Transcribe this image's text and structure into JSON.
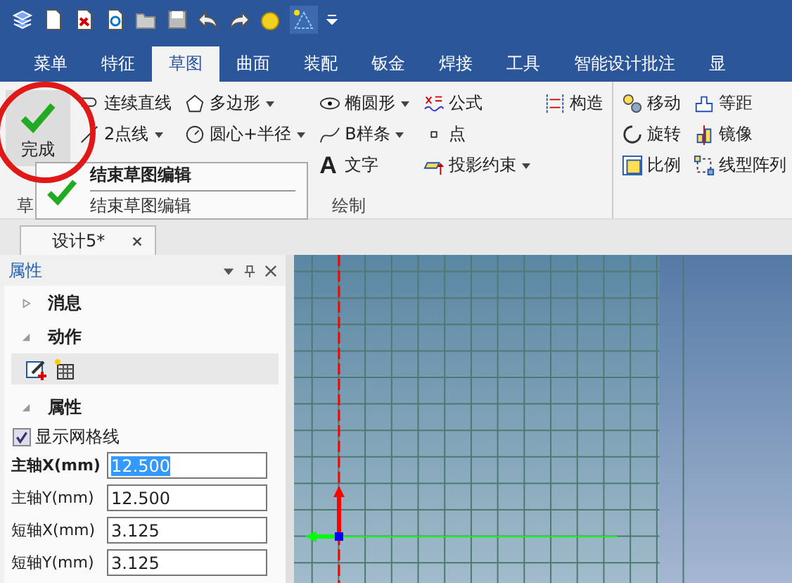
{
  "tabs": [
    {
      "label": "菜单",
      "selected": false
    },
    {
      "label": "特征",
      "selected": false
    },
    {
      "label": "草图",
      "selected": true
    },
    {
      "label": "曲面",
      "selected": false
    },
    {
      "label": "装配",
      "selected": false
    },
    {
      "label": "钣金",
      "selected": false
    },
    {
      "label": "焊接",
      "selected": false
    },
    {
      "label": "工具",
      "selected": false
    },
    {
      "label": "智能设计批注",
      "selected": false
    },
    {
      "label": "显",
      "selected": false
    }
  ],
  "ribbon": {
    "finish_button": "完成",
    "groups": [
      {
        "label": "草"
      },
      {
        "label": "绘制",
        "columns": [
          [
            {
              "kind": "polyline",
              "label": "连续直线",
              "dropdown": false
            },
            {
              "kind": "line",
              "label": "2点线",
              "dropdown": true
            }
          ],
          [
            {
              "kind": "polygon",
              "label": "多边形",
              "dropdown": true
            },
            {
              "kind": "circle",
              "label": "圆心+半径",
              "dropdown": true
            }
          ],
          [
            {
              "kind": "ellipse",
              "label": "椭圆形",
              "dropdown": true
            },
            {
              "kind": "spline",
              "label": "B样条",
              "dropdown": true
            },
            {
              "kind": "text",
              "icon": "A",
              "label": "文字",
              "dropdown": false
            }
          ],
          [
            {
              "kind": "formula",
              "label": "公式",
              "dropdown": false
            },
            {
              "kind": "point",
              "label": "点",
              "dropdown": false
            },
            {
              "kind": "project",
              "label": "投影约束",
              "dropdown": true
            }
          ],
          [
            {
              "kind": "construct",
              "label": "构造",
              "dropdown": false
            }
          ]
        ]
      },
      {
        "columns": [
          [
            {
              "kind": "move",
              "label": "移动",
              "dropdown": false
            },
            {
              "kind": "rotate",
              "label": "旋转",
              "dropdown": false
            },
            {
              "kind": "scale",
              "label": "比例",
              "dropdown": false
            }
          ],
          [
            {
              "kind": "offset",
              "label": "等距",
              "dropdown": false
            },
            {
              "kind": "mirror",
              "label": "镜像",
              "dropdown": false
            },
            {
              "kind": "pattern",
              "label": "线型阵列",
              "dropdown": false
            }
          ]
        ]
      }
    ],
    "tooltip": {
      "title": "结束草图编辑",
      "description": "结束草图编辑"
    }
  },
  "document_tab": {
    "title": "设计5*"
  },
  "panel": {
    "title": "属性",
    "sections": [
      {
        "label": "消息",
        "expanded": false
      },
      {
        "label": "动作",
        "expanded": true
      },
      {
        "label": "属性",
        "expanded": true
      }
    ],
    "checkbox": {
      "label": "显示网格线",
      "checked": true
    },
    "fields": [
      {
        "label": "主轴X(mm)",
        "value": "12.500",
        "selected": true
      },
      {
        "label": "主轴Y(mm)",
        "value": "12.500",
        "selected": false
      },
      {
        "label": "短轴X(mm)",
        "value": "3.125",
        "selected": false
      },
      {
        "label": "短轴Y(mm)",
        "value": "3.125",
        "selected": false
      }
    ]
  }
}
